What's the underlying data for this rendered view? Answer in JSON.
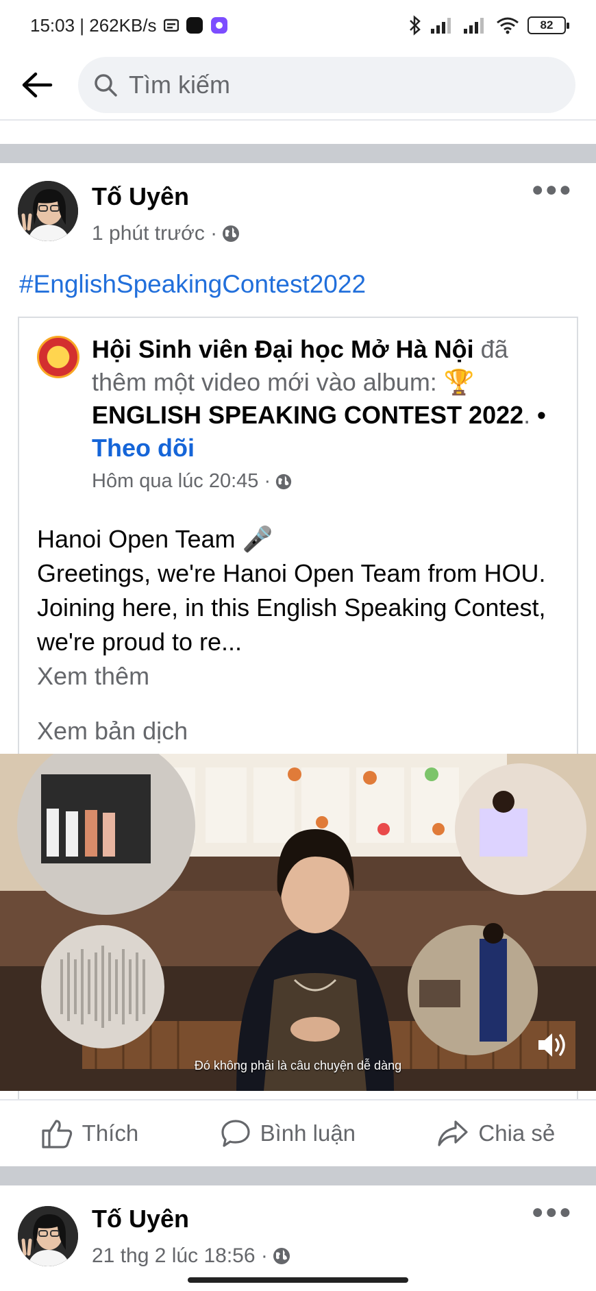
{
  "status_bar": {
    "time_speed": "15:03 | 262KB/s",
    "battery": "82"
  },
  "search": {
    "placeholder": "Tìm kiếm"
  },
  "post1": {
    "author": "Tố Uyên",
    "time": "1 phút trước ·",
    "hashtag": "#EnglishSpeakingContest2022",
    "shared": {
      "page_name": "Hội Sinh viên Đại học Mở Hà Nội",
      "action_text": " đã thêm một video mới vào album: 🏆",
      "album": "ENGLISH SPEAKING CONTEST 2022",
      "album_suffix": ". ",
      "dot": " • ",
      "follow": "Theo dõi",
      "time": "Hôm qua lúc 20:45 ·",
      "text_title": "Hanoi Open Team 🎤",
      "text_body": "Greetings, we're Hanoi Open Team from HOU. Joining here, in this English Speaking Contest, we're proud to re...",
      "see_more": "Xem thêm",
      "see_translation": "Xem bản dịch",
      "video_caption": "Đó không phải là câu chuyện dễ dàng"
    },
    "actions": {
      "like": "Thích",
      "comment": "Bình luận",
      "share": "Chia sẻ"
    }
  },
  "post2": {
    "author": "Tố Uyên",
    "time": "21 thg 2 lúc 18:56 ·"
  },
  "colors": {
    "link_blue": "#216fdb",
    "separator": "#c9ccd1",
    "muted_text": "#65676b"
  }
}
